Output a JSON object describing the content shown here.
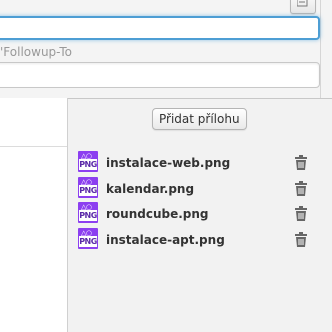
{
  "header": {
    "followup_field_label": "'Followup-To"
  },
  "attachments": {
    "add_button_label": "Přidat přílohu",
    "items": [
      {
        "name": "instalace-web.png",
        "type_label": "PNG",
        "icon": "png-file-icon"
      },
      {
        "name": "kalendar.png",
        "type_label": "PNG",
        "icon": "png-file-icon"
      },
      {
        "name": "roundcube.png",
        "type_label": "PNG",
        "icon": "png-file-icon"
      },
      {
        "name": "instalace-apt.png",
        "type_label": "PNG",
        "icon": "png-file-icon"
      }
    ]
  },
  "colors": {
    "focus_border": "#4d9ed4",
    "file_icon": "#8c3ff0",
    "pane_bg": "#f2f2f2"
  }
}
